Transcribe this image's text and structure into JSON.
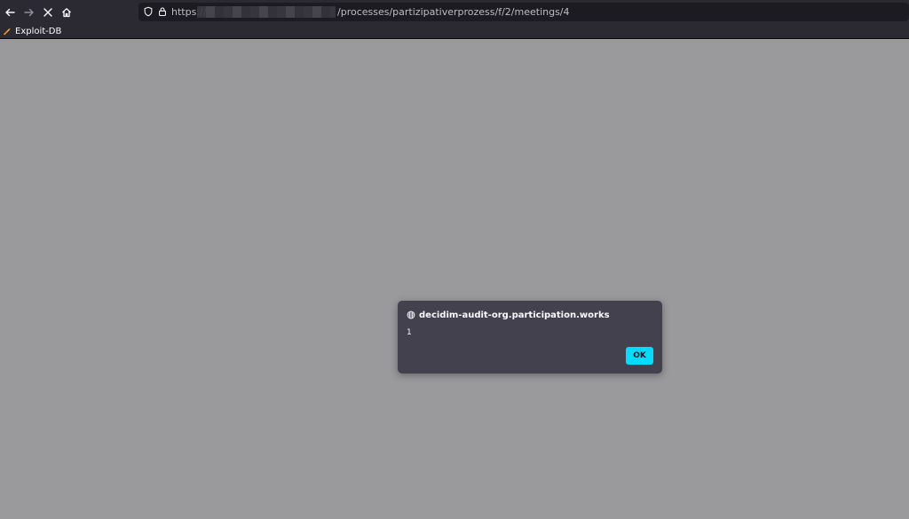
{
  "toolbar": {
    "back_icon": "arrow-left-icon",
    "forward_icon": "arrow-right-icon",
    "stop_icon": "close-icon",
    "home_icon": "home-icon"
  },
  "urlbar": {
    "shield_icon": "shield-icon",
    "lock_icon": "lock-icon",
    "scheme": "https://",
    "path": "/processes/partizipativerprozess/f/2/meetings/4"
  },
  "bookmarks": {
    "items": [
      {
        "label": "Exploit-DB",
        "icon": "exploit-db-icon"
      }
    ]
  },
  "dialog": {
    "icon": "globe-icon",
    "title": "decidim-audit-org.participation.works",
    "message": "1",
    "ok_label": "OK"
  },
  "colors": {
    "chrome_bg": "#2b2a33",
    "urlbar_bg": "#1c1b22",
    "page_bg": "#9a999b",
    "dialog_bg": "#42414d",
    "accent": "#00ddff"
  }
}
